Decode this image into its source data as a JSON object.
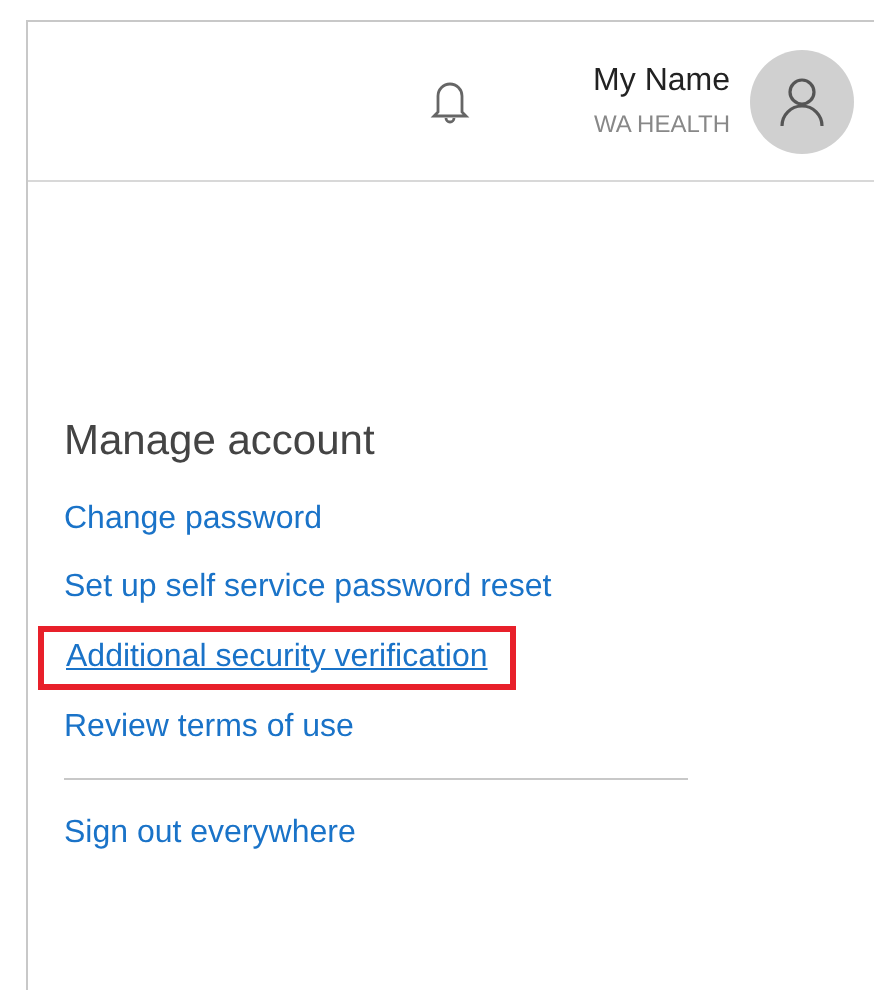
{
  "header": {
    "user_name": "My Name",
    "organization": "WA HEALTH"
  },
  "manage_account": {
    "title": "Manage account",
    "links": [
      {
        "label": "Change password",
        "highlighted": false
      },
      {
        "label": "Set up self service password reset",
        "highlighted": false
      },
      {
        "label": "Additional security verification",
        "highlighted": true
      },
      {
        "label": "Review terms of use",
        "highlighted": false
      }
    ],
    "footer_links": [
      {
        "label": "Sign out everywhere",
        "highlighted": false
      }
    ]
  }
}
